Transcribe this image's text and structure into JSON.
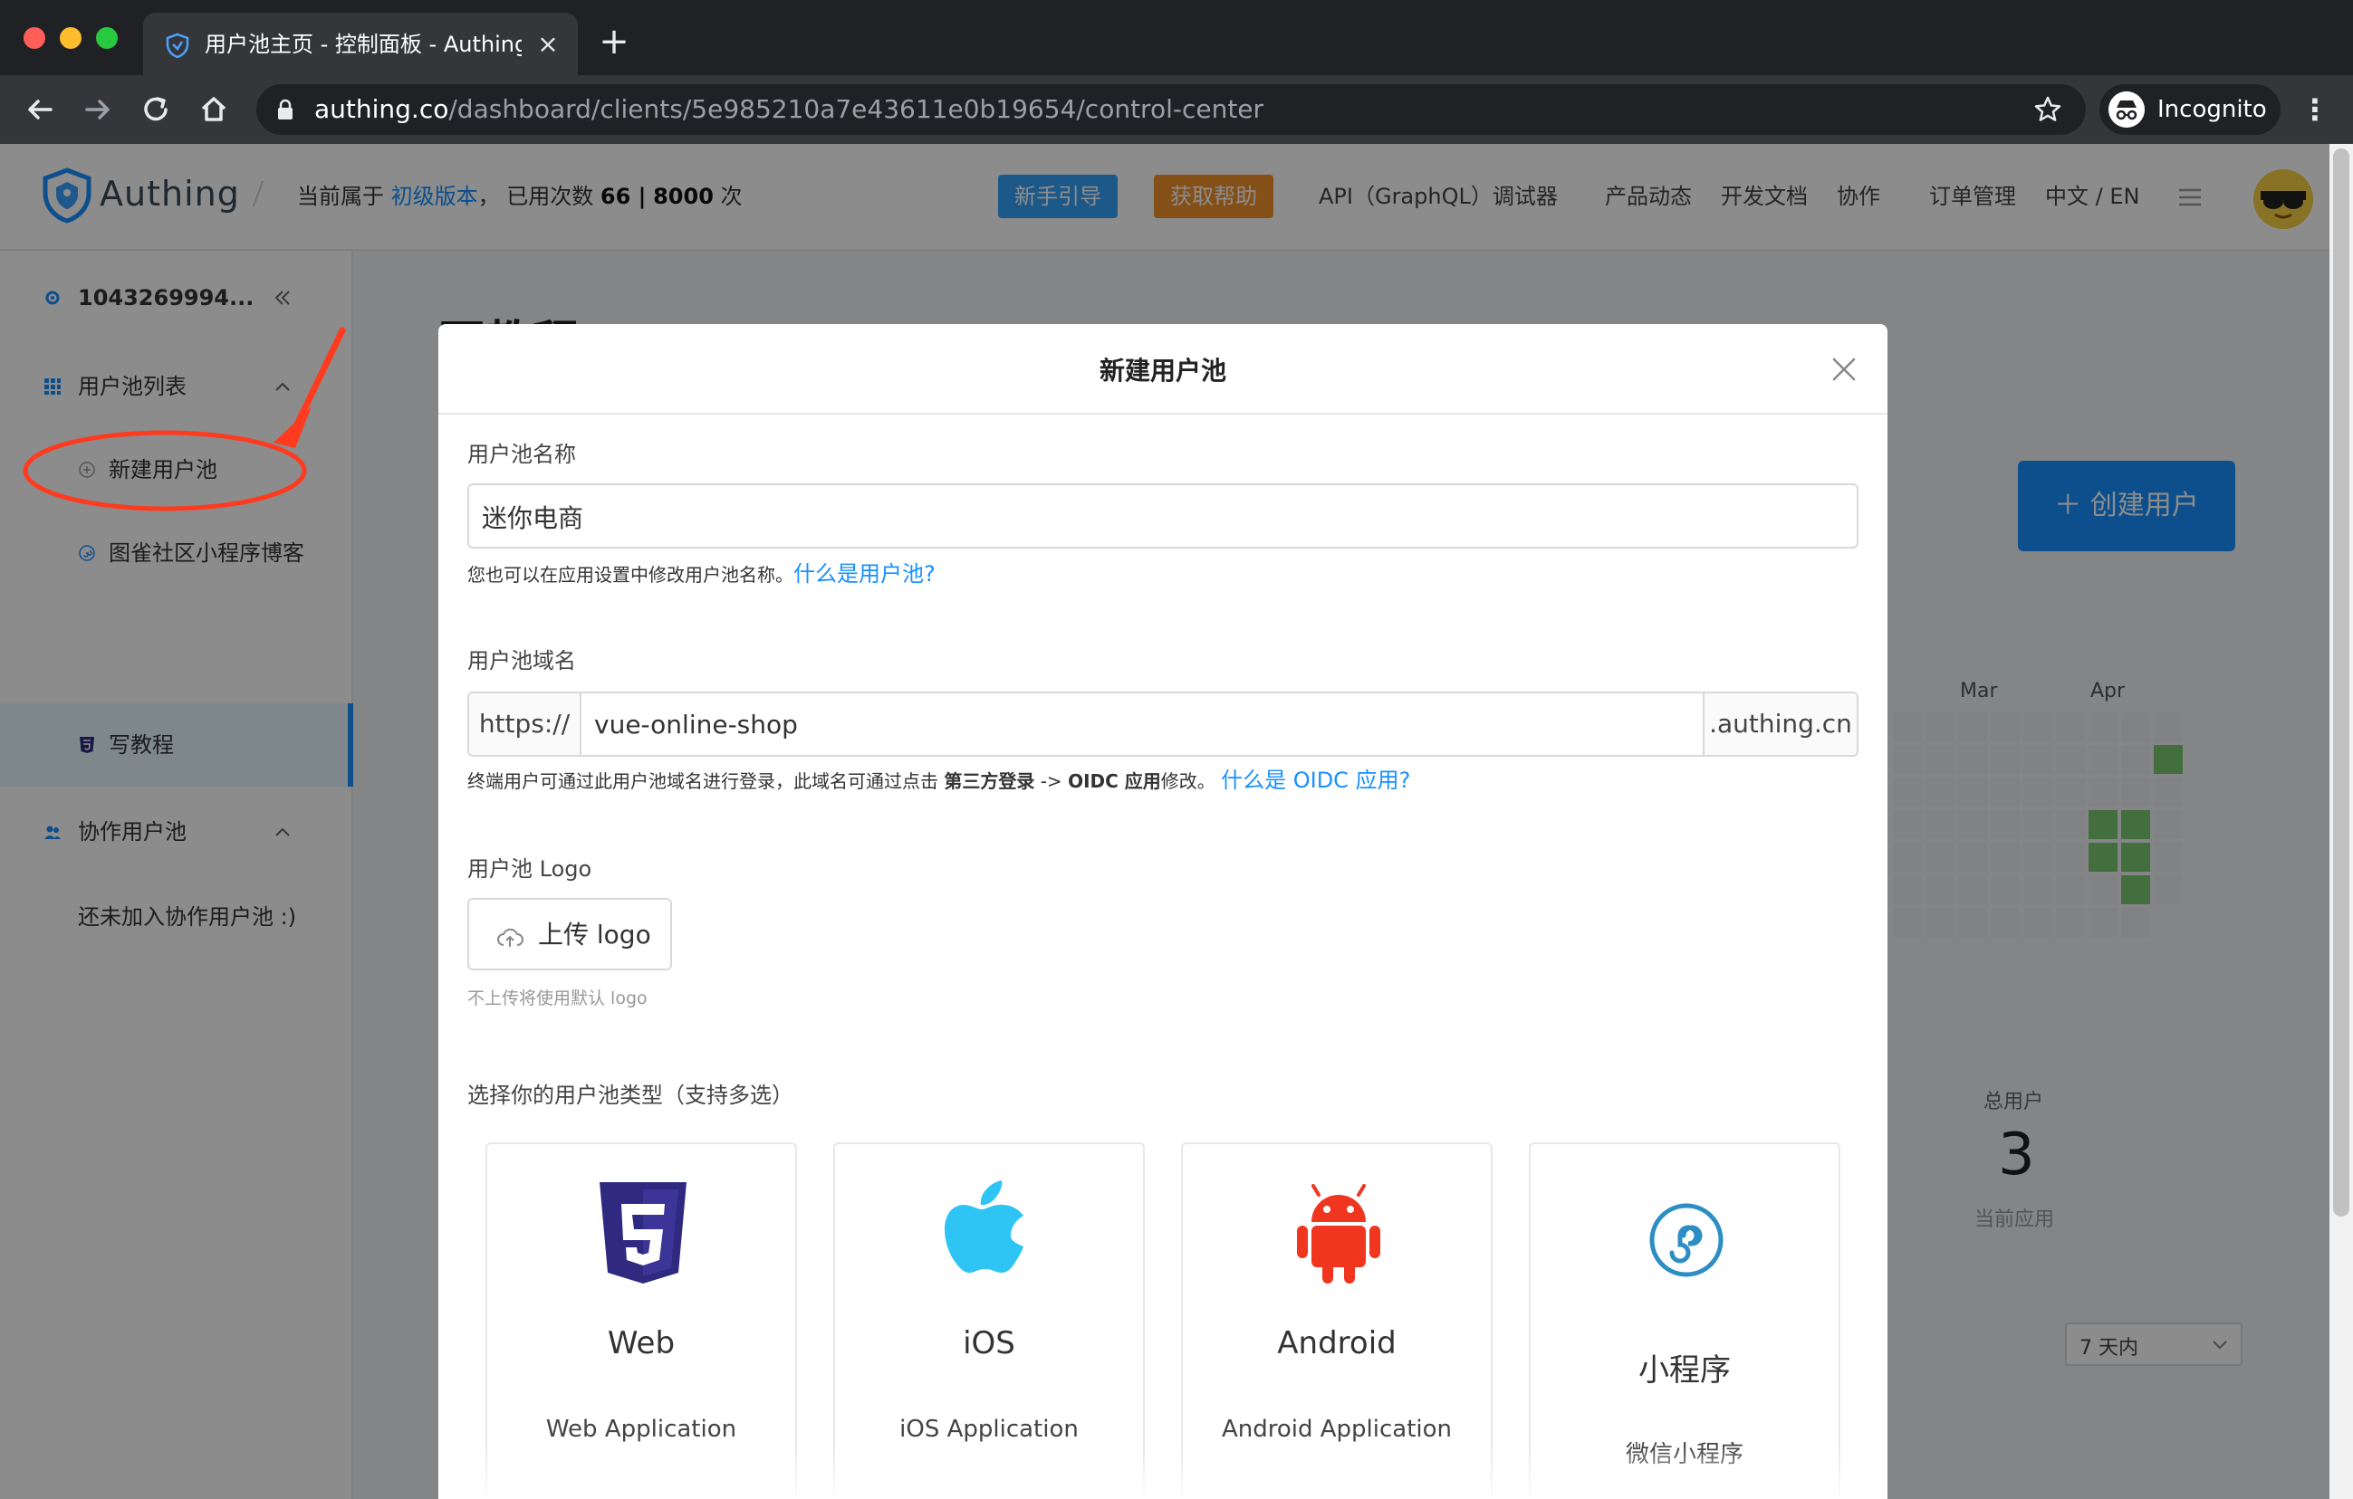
{
  "browser": {
    "tab_title": "用户池主页 - 控制面板 - Authing",
    "new_tab": "+",
    "url_host": "authing.co",
    "url_path": "/dashboard/clients/5e985210a7e43611e0b19654/control-center",
    "incognito_label": "Incognito"
  },
  "header": {
    "logo_text": "Authing",
    "plan_prefix": "当前属于",
    "plan_name": "初级版本",
    "usage_prefix": "， 已用次数",
    "usage_used": "66 |",
    "usage_total": "8000",
    "usage_suffix": "次",
    "guide_button": "新手引导",
    "help_button": "获取帮助",
    "links": [
      "API（GraphQL）调试器",
      "产品动态",
      "开发文档",
      "协作",
      "订单管理",
      "中文 / EN"
    ]
  },
  "sidebar": {
    "pool_id": "1043269994...",
    "pool_list_label": "用户池列表",
    "new_pool_label": "新建用户池",
    "pool_item_1": "图雀社区小程序博客",
    "pool_item_2": "写教程",
    "collab_label": "协作用户池",
    "collab_empty": "还未加入协作用户池 :)"
  },
  "main": {
    "title": "写教程",
    "create_user_button": "创建用户",
    "months": [
      "Mar",
      "Apr"
    ],
    "stat_label": "总用户",
    "stat_value": "3",
    "stat_sub": "当前应用",
    "range_select": "7 天内"
  },
  "modal": {
    "title": "新建用户池",
    "name_label": "用户池名称",
    "name_value": "迷你电商",
    "name_hint": "您也可以在应用设置中修改用户池名称。",
    "name_hint_link": "什么是用户池?",
    "domain_label": "用户池域名",
    "domain_prefix": "https://",
    "domain_value": "vue-online-shop",
    "domain_suffix": ".authing.cn",
    "domain_hint_1": "终端用户可通过此用户池域名进行登录，此域名可通过点击",
    "domain_hint_bold_1": "第三方登录",
    "domain_hint_arrow": "->",
    "domain_hint_bold_2": "OIDC 应用",
    "domain_hint_2": "修改。",
    "domain_hint_link": "什么是 OIDC 应用?",
    "logo_label": "用户池 Logo",
    "upload_button": "上传 logo",
    "logo_hint": "不上传将使用默认 logo",
    "type_label": "选择你的用户池类型（支持多选）",
    "types": [
      {
        "title": "Web",
        "subtitle": "Web Application",
        "icon": "html5-icon"
      },
      {
        "title": "iOS",
        "subtitle": "iOS Application",
        "icon": "apple-icon"
      },
      {
        "title": "Android",
        "subtitle": "Android Application",
        "icon": "android-icon"
      },
      {
        "title": "小程序",
        "subtitle": "微信小程序",
        "icon": "miniprogram-icon"
      }
    ]
  },
  "colors": {
    "accent": "#1890ff",
    "annotation": "#ff3b1f",
    "html5": "#2f2a80",
    "apple": "#2ec5f5",
    "android": "#f0361f",
    "miniprogram": "#2d8ec4"
  }
}
